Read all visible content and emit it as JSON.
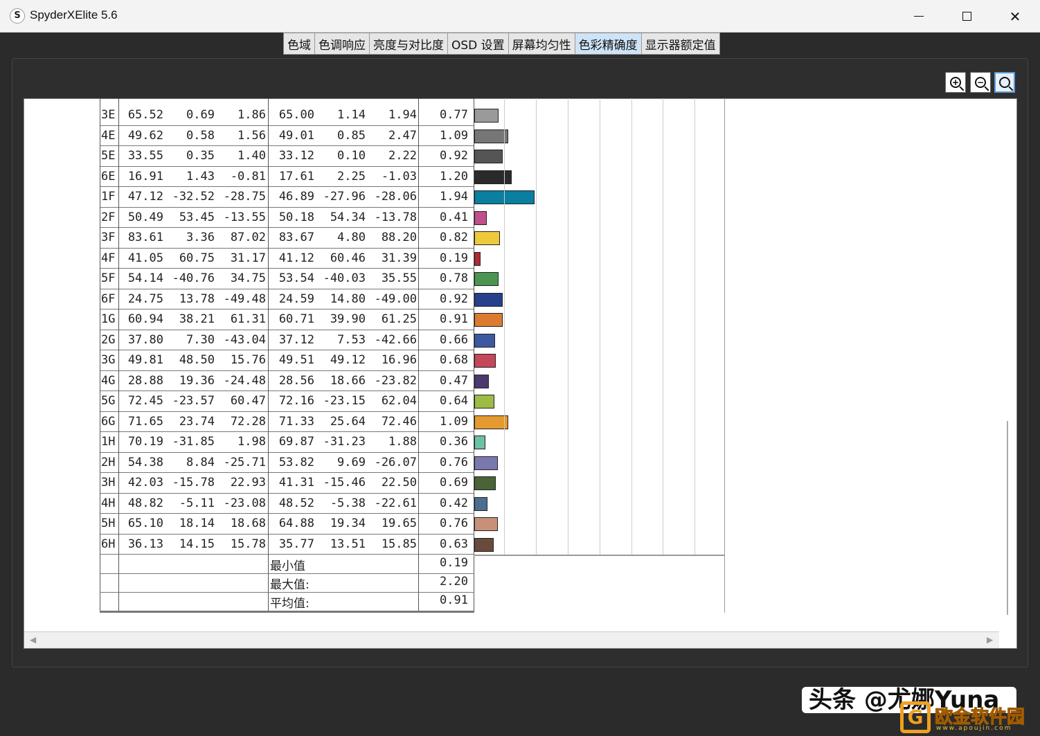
{
  "window": {
    "title": "SpyderXElite 5.6",
    "icon_letter": "S"
  },
  "tabs": [
    {
      "label": "色域",
      "active": false
    },
    {
      "label": "色调响应",
      "active": false
    },
    {
      "label": "亮度与对比度",
      "active": false
    },
    {
      "label": "OSD 设置",
      "active": false
    },
    {
      "label": "屏幕均匀性",
      "active": false
    },
    {
      "label": "色彩精确度",
      "active": true
    },
    {
      "label": "显示器额定值",
      "active": false
    }
  ],
  "colors": {
    "active_tab": "#cfe3f7",
    "window_bg": "#2b2b2b"
  },
  "report": {
    "rows": [
      {
        "id": "3E",
        "ref_L": "65.52",
        "ref_a": "0.69",
        "ref_b": "1.86",
        "meas_L": "65.00",
        "meas_a": "1.14",
        "meas_b": "1.94",
        "de": 0.77,
        "de_text": "0.77",
        "color": "#9a9a9a"
      },
      {
        "id": "4E",
        "ref_L": "49.62",
        "ref_a": "0.58",
        "ref_b": "1.56",
        "meas_L": "49.01",
        "meas_a": "0.85",
        "meas_b": "2.47",
        "de": 1.09,
        "de_text": "1.09",
        "color": "#767676"
      },
      {
        "id": "5E",
        "ref_L": "33.55",
        "ref_a": "0.35",
        "ref_b": "1.40",
        "meas_L": "33.12",
        "meas_a": "0.10",
        "meas_b": "2.22",
        "de": 0.92,
        "de_text": "0.92",
        "color": "#555555"
      },
      {
        "id": "6E",
        "ref_L": "16.91",
        "ref_a": "1.43",
        "ref_b": "-0.81",
        "meas_L": "17.61",
        "meas_a": "2.25",
        "meas_b": "-1.03",
        "de": 1.2,
        "de_text": "1.20",
        "color": "#2a2a2a"
      },
      {
        "id": "1F",
        "ref_L": "47.12",
        "ref_a": "-32.52",
        "ref_b": "-28.75",
        "meas_L": "46.89",
        "meas_a": "-27.96",
        "meas_b": "-28.06",
        "de": 1.94,
        "de_text": "1.94",
        "color": "#0a7fa0"
      },
      {
        "id": "2F",
        "ref_L": "50.49",
        "ref_a": "53.45",
        "ref_b": "-13.55",
        "meas_L": "50.18",
        "meas_a": "54.34",
        "meas_b": "-13.78",
        "de": 0.41,
        "de_text": "0.41",
        "color": "#c0508a"
      },
      {
        "id": "3F",
        "ref_L": "83.61",
        "ref_a": "3.36",
        "ref_b": "87.02",
        "meas_L": "83.67",
        "meas_a": "4.80",
        "meas_b": "88.20",
        "de": 0.82,
        "de_text": "0.82",
        "color": "#eec93a"
      },
      {
        "id": "4F",
        "ref_L": "41.05",
        "ref_a": "60.75",
        "ref_b": "31.17",
        "meas_L": "41.12",
        "meas_a": "60.46",
        "meas_b": "31.39",
        "de": 0.19,
        "de_text": "0.19",
        "color": "#b02a36"
      },
      {
        "id": "5F",
        "ref_L": "54.14",
        "ref_a": "-40.76",
        "ref_b": "34.75",
        "meas_L": "53.54",
        "meas_a": "-40.03",
        "meas_b": "35.55",
        "de": 0.78,
        "de_text": "0.78",
        "color": "#4a9650"
      },
      {
        "id": "6F",
        "ref_L": "24.75",
        "ref_a": "13.78",
        "ref_b": "-49.48",
        "meas_L": "24.59",
        "meas_a": "14.80",
        "meas_b": "-49.00",
        "de": 0.92,
        "de_text": "0.92",
        "color": "#26408a"
      },
      {
        "id": "1G",
        "ref_L": "60.94",
        "ref_a": "38.21",
        "ref_b": "61.31",
        "meas_L": "60.71",
        "meas_a": "39.90",
        "meas_b": "61.25",
        "de": 0.91,
        "de_text": "0.91",
        "color": "#dc7a30"
      },
      {
        "id": "2G",
        "ref_L": "37.80",
        "ref_a": "7.30",
        "ref_b": "-43.04",
        "meas_L": "37.12",
        "meas_a": "7.53",
        "meas_b": "-42.66",
        "de": 0.66,
        "de_text": "0.66",
        "color": "#3c5aa0"
      },
      {
        "id": "3G",
        "ref_L": "49.81",
        "ref_a": "48.50",
        "ref_b": "15.76",
        "meas_L": "49.51",
        "meas_a": "49.12",
        "meas_b": "16.96",
        "de": 0.68,
        "de_text": "0.68",
        "color": "#c44858"
      },
      {
        "id": "4G",
        "ref_L": "28.88",
        "ref_a": "19.36",
        "ref_b": "-24.48",
        "meas_L": "28.56",
        "meas_a": "18.66",
        "meas_b": "-23.82",
        "de": 0.47,
        "de_text": "0.47",
        "color": "#4a3a6e"
      },
      {
        "id": "5G",
        "ref_L": "72.45",
        "ref_a": "-23.57",
        "ref_b": "60.47",
        "meas_L": "72.16",
        "meas_a": "-23.15",
        "meas_b": "62.04",
        "de": 0.64,
        "de_text": "0.64",
        "color": "#9cbc46"
      },
      {
        "id": "6G",
        "ref_L": "71.65",
        "ref_a": "23.74",
        "ref_b": "72.28",
        "meas_L": "71.33",
        "meas_a": "25.64",
        "meas_b": "72.46",
        "de": 1.09,
        "de_text": "1.09",
        "color": "#e49a30"
      },
      {
        "id": "1H",
        "ref_L": "70.19",
        "ref_a": "-31.85",
        "ref_b": "1.98",
        "meas_L": "69.87",
        "meas_a": "-31.23",
        "meas_b": "1.88",
        "de": 0.36,
        "de_text": "0.36",
        "color": "#6ec0a8"
      },
      {
        "id": "2H",
        "ref_L": "54.38",
        "ref_a": "8.84",
        "ref_b": "-25.71",
        "meas_L": "53.82",
        "meas_a": "9.69",
        "meas_b": "-26.07",
        "de": 0.76,
        "de_text": "0.76",
        "color": "#7a78ae"
      },
      {
        "id": "3H",
        "ref_L": "42.03",
        "ref_a": "-15.78",
        "ref_b": "22.93",
        "meas_L": "41.31",
        "meas_a": "-15.46",
        "meas_b": "22.50",
        "de": 0.69,
        "de_text": "0.69",
        "color": "#4a6438"
      },
      {
        "id": "4H",
        "ref_L": "48.82",
        "ref_a": "-5.11",
        "ref_b": "-23.08",
        "meas_L": "48.52",
        "meas_a": "-5.38",
        "meas_b": "-22.61",
        "de": 0.42,
        "de_text": "0.42",
        "color": "#4a6e90"
      },
      {
        "id": "5H",
        "ref_L": "65.10",
        "ref_a": "18.14",
        "ref_b": "18.68",
        "meas_L": "64.88",
        "meas_a": "19.34",
        "meas_b": "19.65",
        "de": 0.76,
        "de_text": "0.76",
        "color": "#c89078"
      },
      {
        "id": "6H",
        "ref_L": "36.13",
        "ref_a": "14.15",
        "ref_b": "15.78",
        "meas_L": "35.77",
        "meas_a": "13.51",
        "meas_b": "15.85",
        "de": 0.63,
        "de_text": "0.63",
        "color": "#6a4a3c"
      }
    ],
    "summary": [
      {
        "label": "最小值",
        "value": "0.19"
      },
      {
        "label": "最大值:",
        "value": "2.20"
      },
      {
        "label": "平均值:",
        "value": "0.91"
      }
    ]
  },
  "watermark": {
    "text": "头条 @尤娜Yuna",
    "logo_text": "欧金软件园",
    "logo_url": "www.apoujin.com"
  }
}
